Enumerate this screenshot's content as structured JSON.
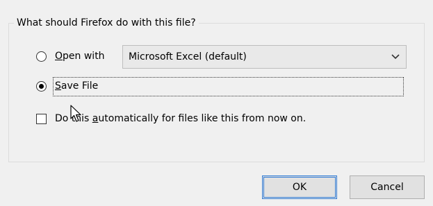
{
  "group": {
    "legend": "What should Firefox do with this file?"
  },
  "open_with": {
    "label_mnemonic": "O",
    "label_rest": "pen with",
    "selected": false,
    "app_value": "Microsoft Excel (default)"
  },
  "save_file": {
    "label_mnemonic": "S",
    "label_rest": "ave File",
    "selected": true
  },
  "auto_checkbox": {
    "checked": false,
    "label_pre": "Do this ",
    "label_mnemonic": "a",
    "label_rest": "utomatically for files like this from now on."
  },
  "buttons": {
    "ok": "OK",
    "cancel": "Cancel"
  }
}
